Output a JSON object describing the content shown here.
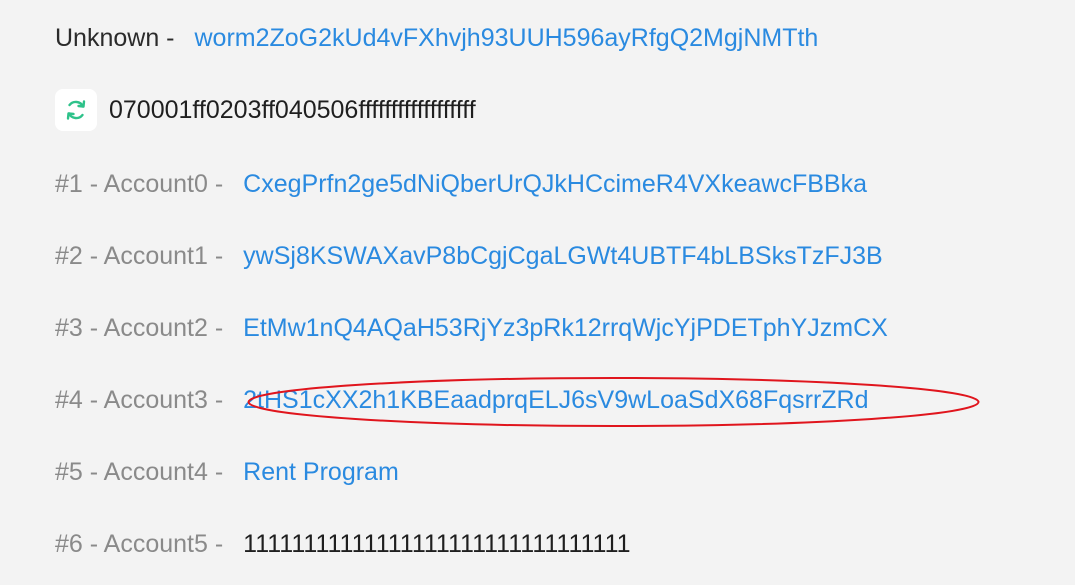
{
  "header": {
    "label": "Unknown -",
    "address": "worm2ZoG2kUd4vFXhvjh93UUH596ayRfgQ2MgjNMTth"
  },
  "instruction": {
    "icon": "refresh-icon",
    "data": "070001ff0203ff040506ffffffffffffffffff"
  },
  "accounts": [
    {
      "label": "#1 - Account0 -",
      "value": "CxegPrfn2ge5dNiQberUrQJkHCcimeR4VXkeawcFBBka"
    },
    {
      "label": "#2 - Account1 -",
      "value": "ywSj8KSWAXavP8bCgjCgaLGWt4UBTF4bLBSksTzFJ3B"
    },
    {
      "label": "#3 - Account2 -",
      "value": "EtMw1nQ4AQaH53RjYz3pRk12rrqWjcYjPDETphYJzmCX"
    },
    {
      "label": "#4 - Account3 -",
      "value": "2tHS1cXX2h1KBEaadprqELJ6sV9wLoaSdX68FqsrrZRd"
    },
    {
      "label": "#5 - Account4 -",
      "value": "Rent Program"
    },
    {
      "label": "#6 - Account5 -",
      "value": "11111111111111111111111111111111"
    }
  ],
  "colors": {
    "link": "#2a8ae0",
    "label": "#8a8a8a",
    "highlight": "#e0151d",
    "icon": "#2ec28a"
  }
}
